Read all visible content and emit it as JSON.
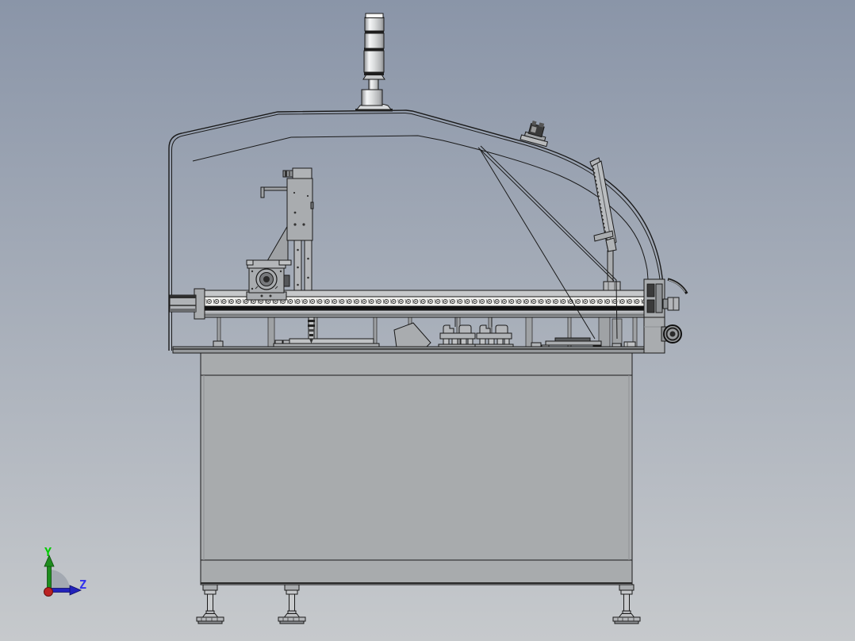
{
  "viewport": {
    "background_top": "#8a95a8",
    "background_bottom": "#c6c9cc",
    "outline_color": "#1a1a1a"
  },
  "machine": {
    "part_fill_light": "#c6c8ca",
    "part_fill_mid": "#a9acaf",
    "part_fill_dark": "#8f9295",
    "rail_strip_fill": "#f1f1ee",
    "rail_stripe_fill": "#101010",
    "cabinet_fill": "#a8abad",
    "tower_cap_fill": "#f8f8f8"
  },
  "triad": {
    "y_axis": {
      "label": "Y",
      "label_color": "#00cc00",
      "arrow_color": "#1e8c1e"
    },
    "z_axis": {
      "label": "Z",
      "label_color": "#3333ee",
      "arrow_color": "#2222bb"
    },
    "x_axis": {
      "color": "#bb2222"
    },
    "sector_color": "#99a0aa"
  }
}
